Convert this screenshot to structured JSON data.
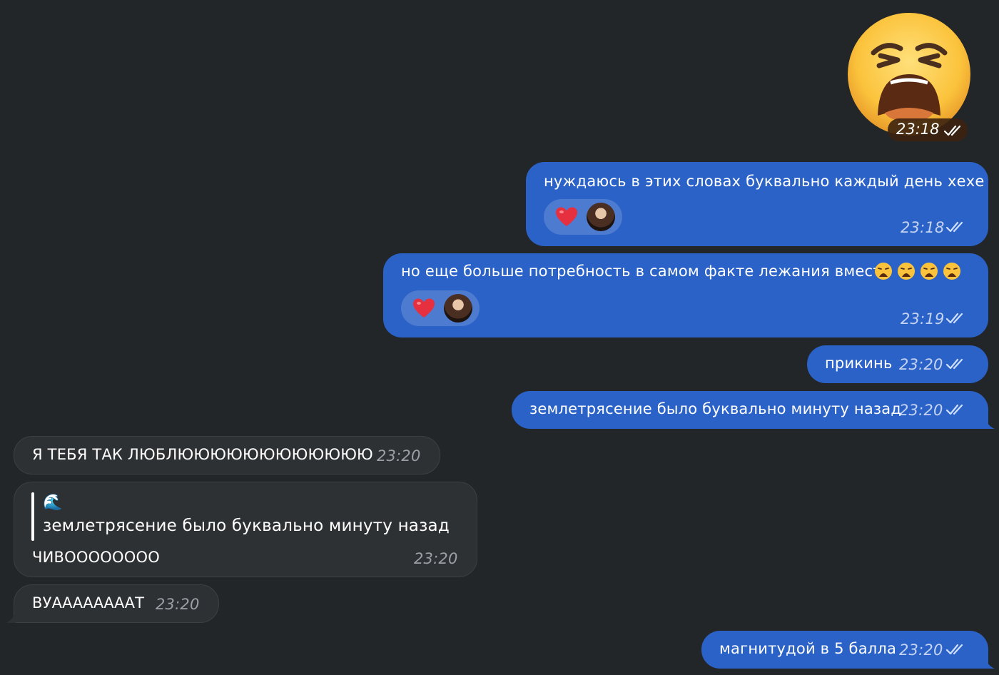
{
  "theme": {
    "bg": "#232629",
    "outgoing": "#2b62c7",
    "incoming": "#2e3134"
  },
  "messages": {
    "m0": {
      "kind": "sticker",
      "sticker": "weary-face",
      "time": "23:18"
    },
    "m1": {
      "text": "нуждаюсь в этих словах буквально каждый день хехе",
      "time": "23:18",
      "reaction": "heart"
    },
    "m2": {
      "text": "но еще больше потребность в самом факте лежания вместе",
      "emojis": [
        "weary-face",
        "weary-face",
        "weary-face",
        "weary-face"
      ],
      "time": "23:19",
      "reaction": "heart"
    },
    "m3": {
      "text": "прикинь",
      "time": "23:20"
    },
    "m4": {
      "text": "землетрясение было буквально минуту назад",
      "time": "23:20"
    },
    "m5": {
      "text": "Я ТЕБЯ ТАК ЛЮБЛЮЮЮЮЮЮЮЮЮЮЮЮ",
      "time": "23:20"
    },
    "m6": {
      "quote_title": "🌊",
      "quote_text": "землетрясение было буквально минуту назад",
      "text": "ЧИВОООООООО",
      "time": "23:20"
    },
    "m7": {
      "text": "ВУААААААААТ",
      "time": "23:20"
    },
    "m8": {
      "text": "магнитудой в 5 балла",
      "time": "23:20"
    }
  }
}
